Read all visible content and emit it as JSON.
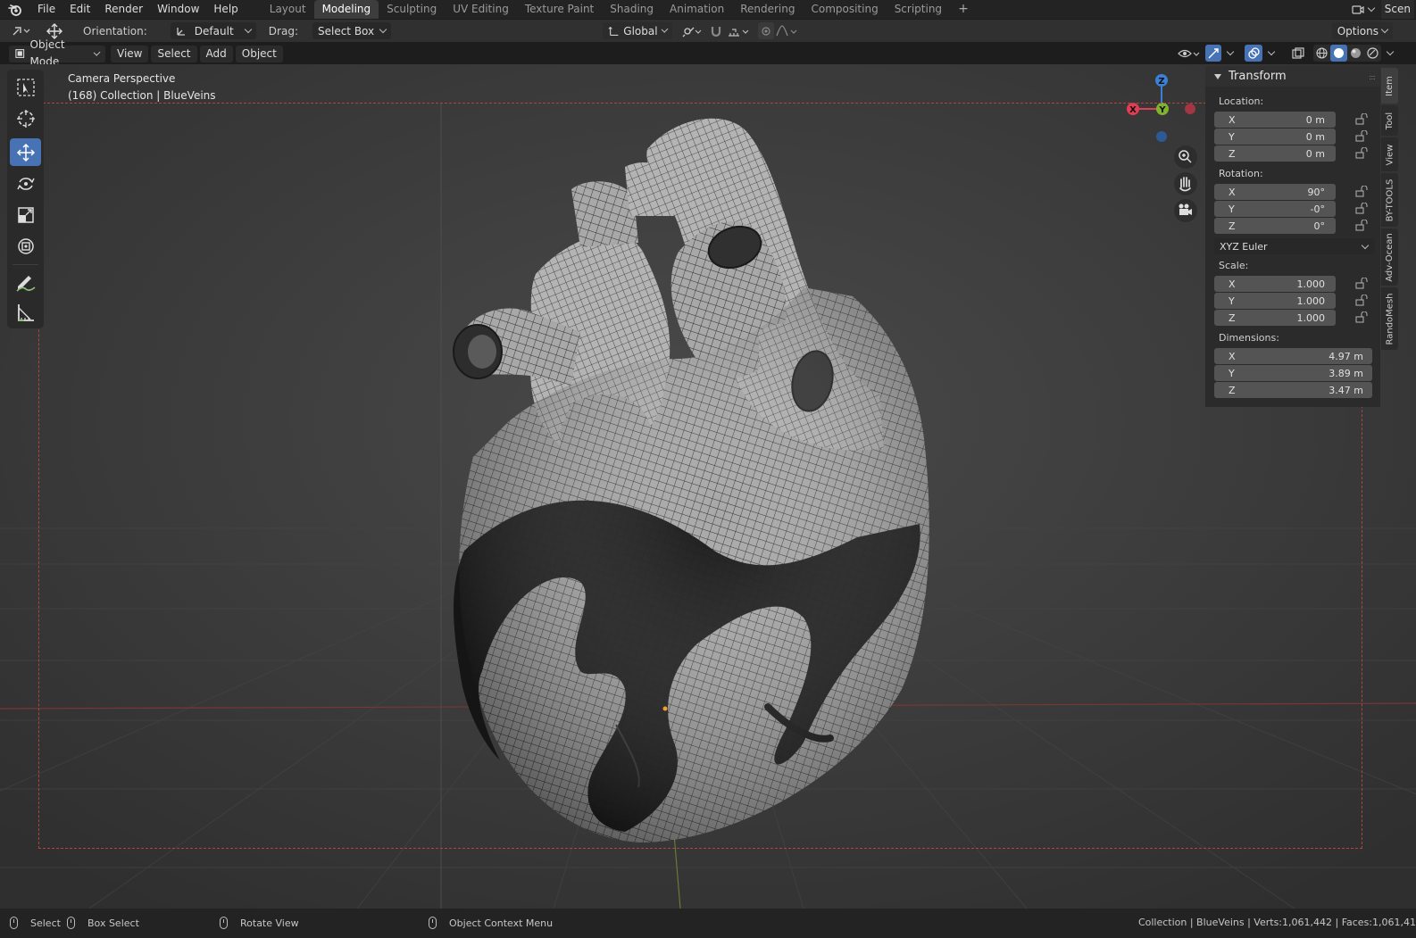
{
  "menu": {
    "items": [
      "File",
      "Edit",
      "Render",
      "Window",
      "Help"
    ]
  },
  "workspaces": {
    "tabs": [
      "Layout",
      "Modeling",
      "Sculpting",
      "UV Editing",
      "Texture Paint",
      "Shading",
      "Animation",
      "Rendering",
      "Compositing",
      "Scripting"
    ],
    "active": "Modeling",
    "add": "+"
  },
  "scene": {
    "label": "Scen"
  },
  "tool_header": {
    "orientation_label": "Orientation:",
    "orientation_value": "Default",
    "drag_label": "Drag:",
    "drag_value": "Select Box",
    "transform_orientation": "Global",
    "options_label": "Options"
  },
  "viewport_header": {
    "mode": "Object Mode",
    "menus": [
      "View",
      "Select",
      "Add",
      "Object"
    ]
  },
  "viewport": {
    "camera_label": "Camera Perspective",
    "collection_label": "(168) Collection | BlueVeins",
    "gizmo": {
      "x": "X",
      "y": "Y",
      "z": "Z"
    },
    "colors": {
      "x_axis": "#e23d52",
      "y_axis": "#7fb32e",
      "z_axis": "#3b7fd6",
      "frame": "#b0443e",
      "active_tool": "#4772b3"
    }
  },
  "toolbar": {
    "tools": [
      "select-box-icon",
      "cursor-icon",
      "move-icon",
      "rotate-icon",
      "scale-icon",
      "transform-icon",
      "annotate-icon",
      "measure-icon"
    ],
    "active": "move-icon"
  },
  "transform_panel": {
    "title": "Transform",
    "location_label": "Location:",
    "location": [
      {
        "axis": "X",
        "value": "0 m"
      },
      {
        "axis": "Y",
        "value": "0 m"
      },
      {
        "axis": "Z",
        "value": "0 m"
      }
    ],
    "rotation_label": "Rotation:",
    "rotation": [
      {
        "axis": "X",
        "value": "90°"
      },
      {
        "axis": "Y",
        "value": "-0°"
      },
      {
        "axis": "Z",
        "value": "0°"
      }
    ],
    "rotation_mode": "XYZ Euler",
    "scale_label": "Scale:",
    "scale": [
      {
        "axis": "X",
        "value": "1.000"
      },
      {
        "axis": "Y",
        "value": "1.000"
      },
      {
        "axis": "Z",
        "value": "1.000"
      }
    ],
    "dimensions_label": "Dimensions:",
    "dimensions": [
      {
        "axis": "X",
        "value": "4.97 m"
      },
      {
        "axis": "Y",
        "value": "3.89 m"
      },
      {
        "axis": "Z",
        "value": "3.47 m"
      }
    ]
  },
  "side_tabs": [
    "Item",
    "Tool",
    "View",
    "BY-TOOLS",
    "Adv-Ocean",
    "RandoMesh"
  ],
  "status_bar": {
    "select": "Select",
    "box_select": "Box Select",
    "rotate_view": "Rotate View",
    "context_menu": "Object Context Menu",
    "stats": "Collection | BlueVeins | Verts:1,061,442 | Faces:1,061,41"
  }
}
